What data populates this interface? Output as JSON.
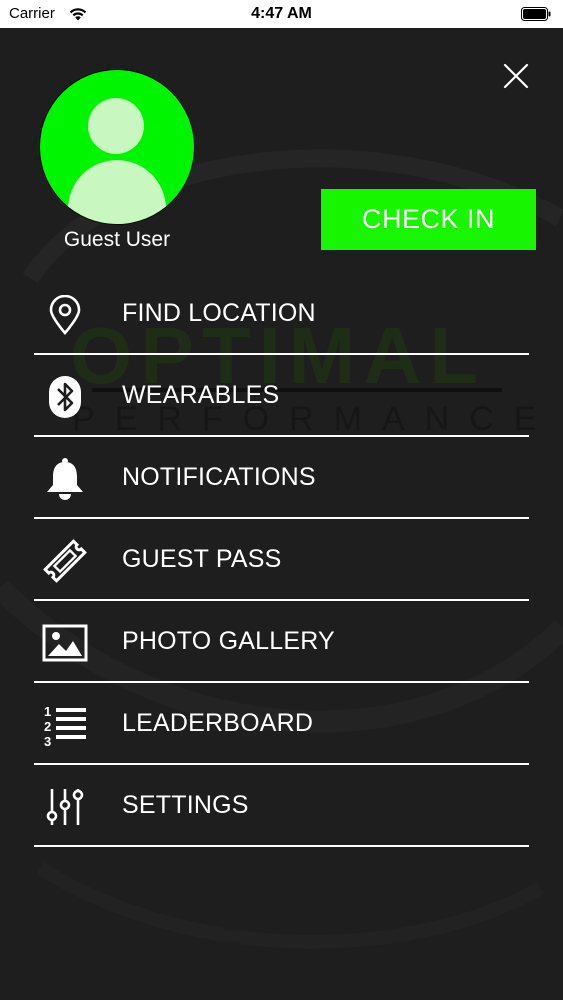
{
  "status_bar": {
    "carrier": "Carrier",
    "time": "4:47 AM"
  },
  "profile": {
    "name": "Guest User"
  },
  "check_in": {
    "label": "CHECK IN"
  },
  "background_logo": {
    "top": "OPTIMAL",
    "bottom": "PERFORMANCE"
  },
  "menu": {
    "items": [
      {
        "label": "FIND LOCATION",
        "icon": "location-pin-icon"
      },
      {
        "label": "WEARABLES",
        "icon": "bluetooth-icon"
      },
      {
        "label": "NOTIFICATIONS",
        "icon": "bell-icon"
      },
      {
        "label": "GUEST PASS",
        "icon": "ticket-icon"
      },
      {
        "label": "PHOTO GALLERY",
        "icon": "image-icon"
      },
      {
        "label": "LEADERBOARD",
        "icon": "numbered-list-icon"
      },
      {
        "label": "SETTINGS",
        "icon": "sliders-icon"
      }
    ]
  },
  "colors": {
    "accent": "#17f500",
    "background": "#1e1e1e",
    "text": "#ffffff"
  }
}
